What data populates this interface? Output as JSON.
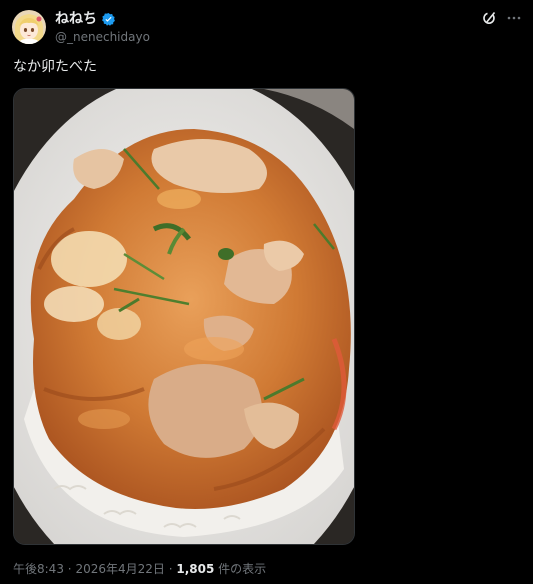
{
  "author": {
    "display_name": "ねねち",
    "handle": "@_nenechidayo",
    "verified": true,
    "avatar_icon": "anime-character-avatar"
  },
  "header_icons": {
    "grok": "grok-icon",
    "more": "more-options-icon"
  },
  "tweet": {
    "text": "なか卯たべた",
    "image_alt": "oyakodon-bowl-photo"
  },
  "meta": {
    "time": "午後8:43",
    "separator": "·",
    "date": "2026年4月22日",
    "views_count": "1,805",
    "views_label": "件の表示"
  },
  "colors": {
    "background": "#000000",
    "text_primary": "#e7e9ea",
    "text_secondary": "#71767b",
    "verified_blue": "#1d9bf0"
  }
}
